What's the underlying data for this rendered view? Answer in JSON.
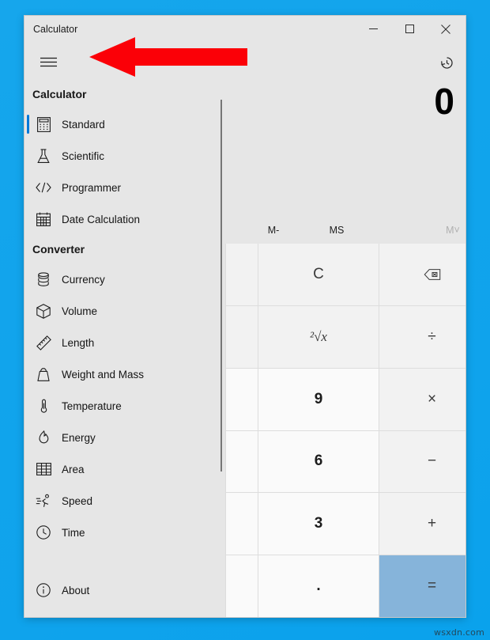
{
  "desktop": {
    "watermark": "wsxdn.com",
    "background_color": "#11a4ec"
  },
  "window": {
    "title": "Calculator",
    "accent_color": "#0078d7",
    "controls": [
      {
        "name": "minimize",
        "glyph": "minimize-icon"
      },
      {
        "name": "maximize",
        "glyph": "maximize-icon"
      },
      {
        "name": "close",
        "glyph": "close-icon"
      }
    ]
  },
  "nav": {
    "menu_button": "hamburger-icon",
    "groups": [
      {
        "title": "Calculator",
        "items": [
          {
            "label": "Standard",
            "icon": "calculator-icon",
            "selected": true
          },
          {
            "label": "Scientific",
            "icon": "flask-icon",
            "selected": false
          },
          {
            "label": "Programmer",
            "icon": "code-icon",
            "selected": false
          },
          {
            "label": "Date Calculation",
            "icon": "calendar-icon",
            "selected": false
          }
        ]
      },
      {
        "title": "Converter",
        "items": [
          {
            "label": "Currency",
            "icon": "coins-icon",
            "selected": false
          },
          {
            "label": "Volume",
            "icon": "cube-icon",
            "selected": false
          },
          {
            "label": "Length",
            "icon": "ruler-icon",
            "selected": false
          },
          {
            "label": "Weight and Mass",
            "icon": "weight-icon",
            "selected": false
          },
          {
            "label": "Temperature",
            "icon": "thermometer-icon",
            "selected": false
          },
          {
            "label": "Energy",
            "icon": "flame-icon",
            "selected": false
          },
          {
            "label": "Area",
            "icon": "grid-icon",
            "selected": false
          },
          {
            "label": "Speed",
            "icon": "speed-icon",
            "selected": false
          },
          {
            "label": "Time",
            "icon": "clock-icon",
            "selected": false
          }
        ]
      }
    ],
    "footer": {
      "label": "About",
      "icon": "info-icon"
    }
  },
  "calculator": {
    "history_button": "history-icon",
    "display_value": "0",
    "memory_buttons": [
      {
        "label": "M-",
        "disabled": false
      },
      {
        "label": "MS",
        "disabled": false
      },
      {
        "label": "M˅",
        "disabled": true
      }
    ],
    "keypad_rows": [
      [
        {
          "label": "",
          "kind": "blank"
        },
        {
          "label": "C",
          "kind": "op"
        },
        {
          "label": "⌫",
          "kind": "backspace"
        }
      ],
      [
        {
          "label": "",
          "kind": "blank"
        },
        {
          "label": "²√x",
          "kind": "op"
        },
        {
          "label": "÷",
          "kind": "op"
        }
      ],
      [
        {
          "label": "",
          "kind": "blanknum"
        },
        {
          "label": "9",
          "kind": "num"
        },
        {
          "label": "×",
          "kind": "op"
        }
      ],
      [
        {
          "label": "",
          "kind": "blanknum"
        },
        {
          "label": "6",
          "kind": "num"
        },
        {
          "label": "−",
          "kind": "op"
        }
      ],
      [
        {
          "label": "",
          "kind": "blanknum"
        },
        {
          "label": "3",
          "kind": "num"
        },
        {
          "label": "+",
          "kind": "op"
        }
      ],
      [
        {
          "label": "",
          "kind": "blanknum"
        },
        {
          "label": ".",
          "kind": "num"
        },
        {
          "label": "=",
          "kind": "eq"
        }
      ]
    ],
    "equals_color": "#86b4da"
  },
  "annotation": {
    "arrow_color": "#fb0007",
    "arrow_direction": "left"
  }
}
